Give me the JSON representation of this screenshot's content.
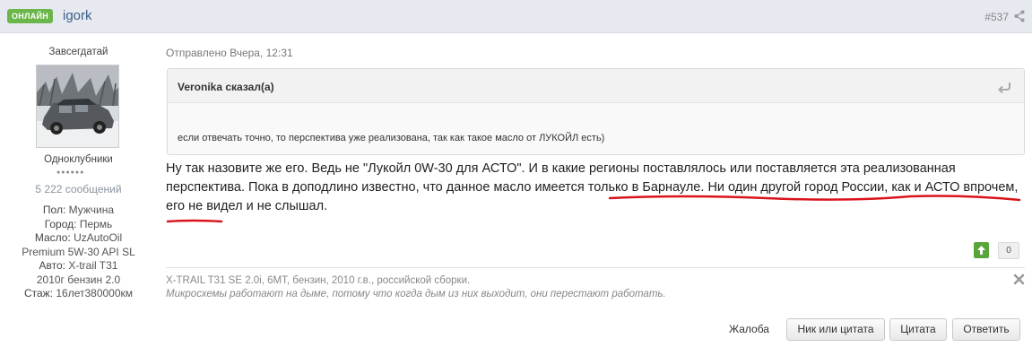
{
  "header": {
    "online_badge": "ОНЛАЙН",
    "author_name": "igork",
    "post_number": "#537",
    "icons": {
      "share": "share-icon"
    }
  },
  "author": {
    "member_title": "Завсегдатай",
    "group": "Одноклубники",
    "rank_pips": "●●●●●●",
    "post_count": "5  222 сообщений",
    "fields": [
      {
        "label": "Пол:",
        "value": "Мужчина"
      },
      {
        "label": "Город:",
        "value": "Пермь"
      },
      {
        "label": "Масло:",
        "value": "UzAutoOil Premium 5W-30 API SL"
      },
      {
        "label": "Авто:",
        "value": "X-trail T31 2010г бензин 2.0"
      },
      {
        "label": "Стаж:",
        "value": "16лет380000км"
      }
    ]
  },
  "post": {
    "posted": "Отправлено Вчера, 12:31",
    "quote": {
      "author": "Veronika сказал(а)",
      "text": "если отвечать точно, то перспектива уже реализована, так как такое масло от ЛУКОЙЛ есть)"
    },
    "body_part1": "Ну так назовите же его. Ведь не \"Лукойл 0W-30 для АСТО\". И в какие регионы поставлялось или поставляется эта реализованная перспектива. Пока в доподлино известно, что данное масло имеется только в Барнауле. ",
    "body_part2": "Ни один другой город России, как и АСТО впрочем, его не видел и не слышал.",
    "reputation": "0"
  },
  "signature": {
    "line1": "X-TRAIL T31 SE 2.0i, 6MT, бензин, 2010 г.в., российской сборки.",
    "line2": "Микросхемы работают на дыме, потому что когда дым из них выходит, они перестают работать."
  },
  "actions": {
    "report": "Жалоба",
    "nick_or_quote": "Ник или цитата",
    "quote": "Цитата",
    "reply": "Ответить"
  },
  "colors": {
    "header_bg": "#e6e9f0",
    "online_badge": "#6bb64a",
    "author_link": "#3b5f8a",
    "rep_up": "#5aa53a",
    "marker_red": "#d9141c"
  }
}
